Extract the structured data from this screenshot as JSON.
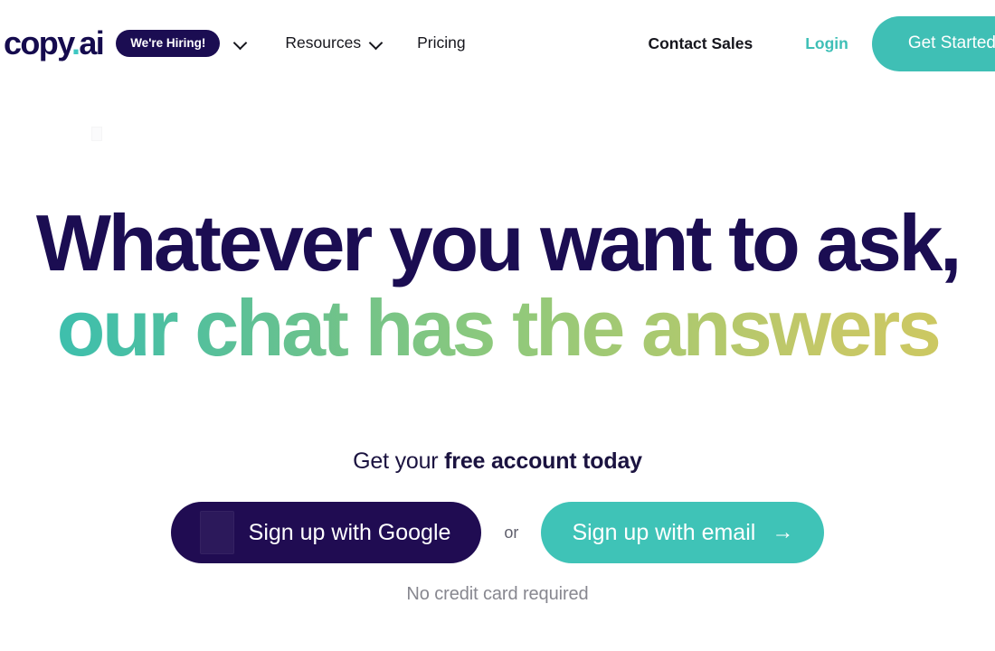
{
  "brand": {
    "logo_text": "copy",
    "logo_dot": ".",
    "logo_suffix": "ai",
    "accent_teal": "#3FBFB5",
    "navy": "#1B0D52",
    "gradient_start": "#36BFB3",
    "gradient_end": "#CFC85F"
  },
  "nav": {
    "hiring_badge": "We're Hiring!",
    "hiring_chevron_icon": "chevron-down-icon",
    "resources_label": "Resources",
    "resources_chevron_icon": "chevron-down-icon",
    "pricing_label": "Pricing",
    "contact_sales_label": "Contact Sales",
    "login_label": "Login",
    "get_started_label": "Get Started"
  },
  "hero": {
    "headline_line1": "Whatever you want to ask,",
    "headline_line2": "our chat has the answers",
    "subhead_prefix": "Get your ",
    "subhead_strong": "free account today",
    "cta_google_label": "Sign up with Google",
    "cta_google_icon": "google-logo-icon",
    "or_label": "or",
    "cta_email_label": "Sign up with email",
    "cta_email_arrow": "→",
    "disclaimer": "No credit card required"
  }
}
